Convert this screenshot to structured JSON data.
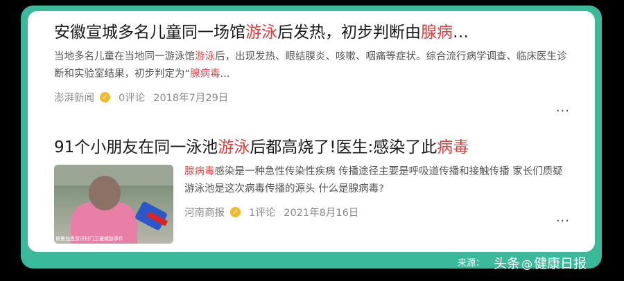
{
  "results": [
    {
      "title_a": "安徽宣城多名儿童同一场馆",
      "title_hl1": "游泳",
      "title_b": "后发热，初步判断由",
      "title_hl2": "腺病",
      "title_c": "…",
      "snippet_a": "当地多名儿童在当地同一游泳馆",
      "snippet_hl1": "游泳",
      "snippet_b": "后，出现发热、眼结膜炎、咳嗽、咽痛等症状。综合流行病学调查、临床医生诊断和实验室结果，初步判定为“",
      "snippet_hl2": "腺病毒",
      "snippet_c": "...",
      "source": "澎湃新闻",
      "verified_icon": "✓",
      "comments": "0评论",
      "date": "2018年7月29日",
      "more": "···"
    },
    {
      "title_a": "91个小朋友在同一泳池",
      "title_hl1": "游泳",
      "title_b": "后都高烧了!医生:感染了此",
      "title_hl2": "病毒",
      "snippet_hl1": "腺病毒",
      "snippet_b": "感染是一种急性传染性疾病 传播途径主要是呼吸道传播和接触传播 家长们质疑游泳池是这次病毒传播的源头 什么是腺病毒?",
      "source": "河南商报",
      "verified_icon": "✓",
      "comments": "1评论",
      "date": "2021年8月16日",
      "more": "···",
      "thumb_caption": "普鲁加恩赏识村门卫被威胁事件"
    }
  ],
  "footer_source": "来源：",
  "watermark": {
    "a": "头条",
    "at": "@",
    "b": "健康日报"
  },
  "colors": {
    "frame": "#3aba9b",
    "highlight": "#e03c3c"
  }
}
